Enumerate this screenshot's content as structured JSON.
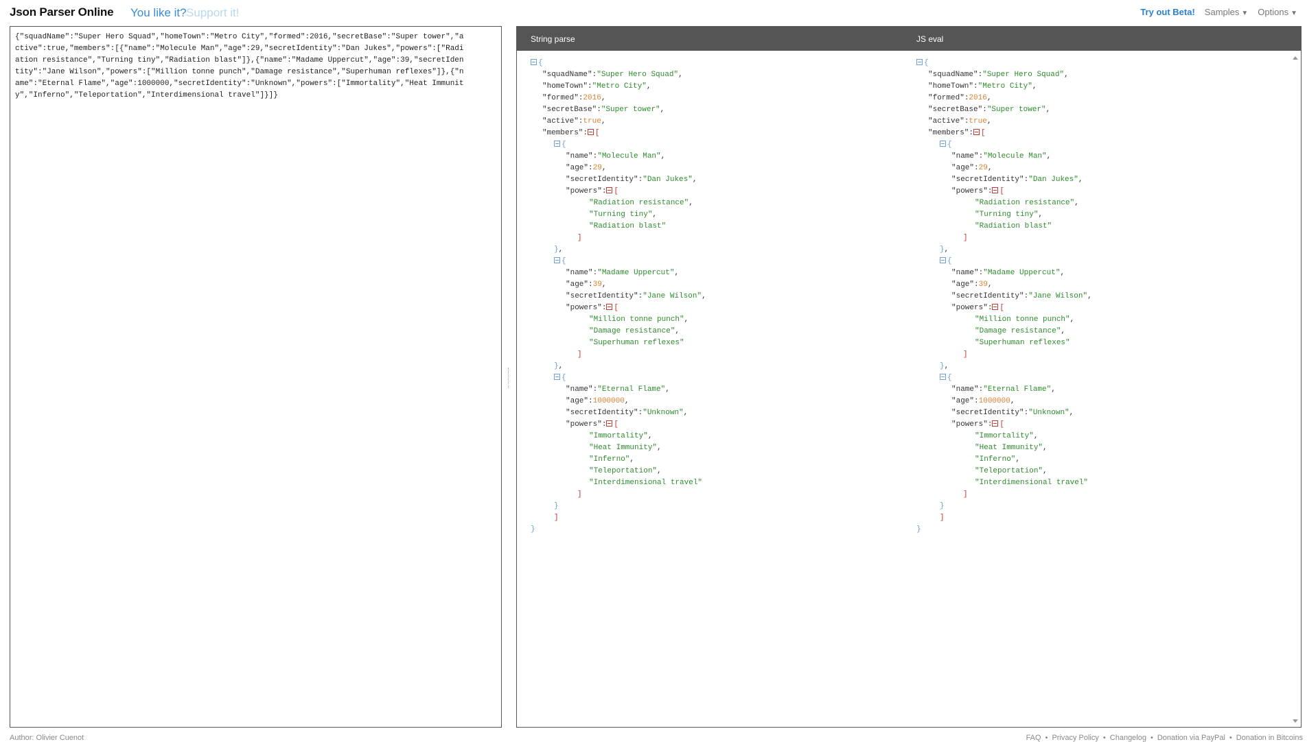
{
  "header": {
    "app_title": "Json Parser Online",
    "like_text": "You like it?",
    "support_link": "Support it!",
    "try_beta": "Try out Beta!",
    "samples_label": "Samples",
    "options_label": "Options"
  },
  "input": {
    "json_text": "{\"squadName\":\"Super Hero Squad\",\"homeTown\":\"Metro City\",\"formed\":2016,\"secretBase\":\"Super tower\",\"active\":true,\"members\":[{\"name\":\"Molecule Man\",\"age\":29,\"secretIdentity\":\"Dan Jukes\",\"powers\":[\"Radiation resistance\",\"Turning tiny\",\"Radiation blast\"]},{\"name\":\"Madame Uppercut\",\"age\":39,\"secretIdentity\":\"Jane Wilson\",\"powers\":[\"Million tonne punch\",\"Damage resistance\",\"Superhuman reflexes\"]},{\"name\":\"Eternal Flame\",\"age\":1000000,\"secretIdentity\":\"Unknown\",\"powers\":[\"Immortality\",\"Heat Immunity\",\"Inferno\",\"Teleportation\",\"Interdimensional travel\"]}]}"
  },
  "output": {
    "left_title": "String parse",
    "right_title": "JS eval",
    "parsed": {
      "squadName": "Super Hero Squad",
      "homeTown": "Metro City",
      "formed": 2016,
      "secretBase": "Super tower",
      "active": true,
      "members": [
        {
          "name": "Molecule Man",
          "age": 29,
          "secretIdentity": "Dan Jukes",
          "powers": [
            "Radiation resistance",
            "Turning tiny",
            "Radiation blast"
          ]
        },
        {
          "name": "Madame Uppercut",
          "age": 39,
          "secretIdentity": "Jane Wilson",
          "powers": [
            "Million tonne punch",
            "Damage resistance",
            "Superhuman reflexes"
          ]
        },
        {
          "name": "Eternal Flame",
          "age": 1000000,
          "secretIdentity": "Unknown",
          "powers": [
            "Immortality",
            "Heat Immunity",
            "Inferno",
            "Teleportation",
            "Interdimensional travel"
          ]
        }
      ]
    }
  },
  "footer": {
    "author": "Author: Olivier Cuenot",
    "links": [
      "FAQ",
      "Privacy Policy",
      "Changelog",
      "Donation via PayPal",
      "Donation in Bitcoins"
    ]
  }
}
